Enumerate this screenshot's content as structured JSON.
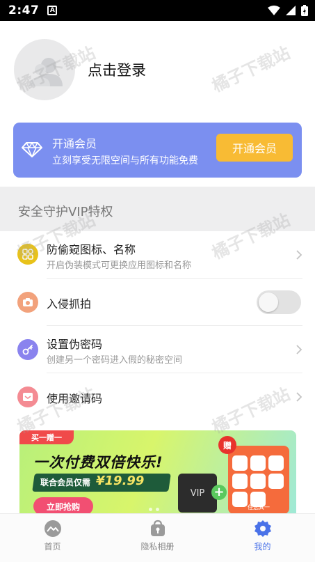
{
  "status_bar": {
    "time": "2:47",
    "a_icon_label": "A"
  },
  "profile": {
    "login_text": "点击登录"
  },
  "vip_card": {
    "title": "开通会员",
    "subtitle": "立刻享受无限空间与所有功能免费",
    "button_label": "开通会员"
  },
  "section": {
    "title": "安全守护VIP特权"
  },
  "features": [
    {
      "label": "防偷窥图标、名称",
      "sub": "开启伪装模式可更换应用图标和名称"
    },
    {
      "label": "入侵抓拍"
    },
    {
      "label": "设置伪密码",
      "sub": "创建另一个密码进入假的秘密空间"
    },
    {
      "label": "使用邀请码"
    }
  ],
  "banner": {
    "tag": "买一赠一",
    "headline": "一次付费双倍快乐!",
    "price_label": "联合会员仅需",
    "price": "¥19.99",
    "buy_label": "立即抢购",
    "vip_tile": "VIP",
    "gift": "赠",
    "apps_caption": "任选其一"
  },
  "tabbar": [
    {
      "label": "首页",
      "icon": "mountain-icon",
      "active": false
    },
    {
      "label": "隐私相册",
      "icon": "lock-album-icon",
      "active": false
    },
    {
      "label": "我的",
      "icon": "gear-icon",
      "active": true
    }
  ],
  "colors": {
    "vip_card_bg": "#7b8ff0",
    "vip_button_bg": "#f8bb34",
    "active_tab": "#4a72e8",
    "icon_yellow": "#e8c21a",
    "icon_orange": "#f2a27c",
    "icon_purple": "#8a83ee",
    "icon_pink": "#f48b93"
  },
  "watermark": "橘子下载站"
}
